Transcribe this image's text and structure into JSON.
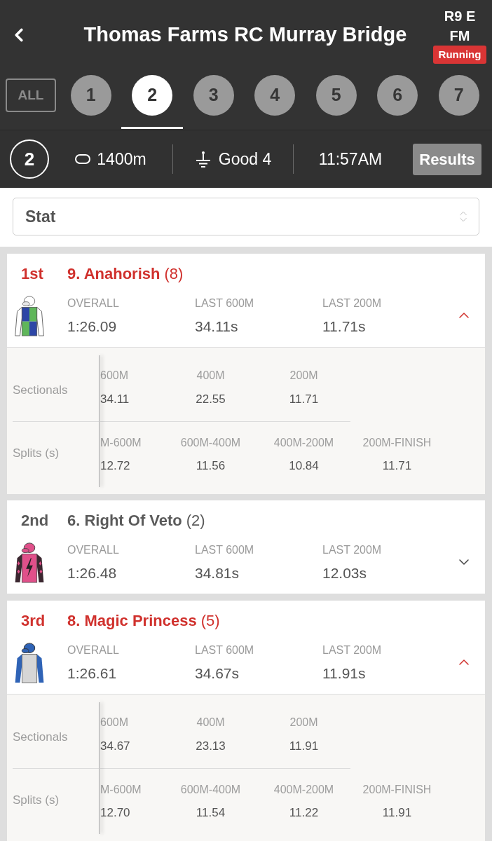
{
  "header": {
    "title": "Thomas Farms RC Murray Bridge",
    "race_code": [
      "R9 E",
      "FM"
    ],
    "status": "Running"
  },
  "race_tabs": [
    {
      "kind": "all",
      "label": "ALL",
      "selected": false
    },
    {
      "kind": "number",
      "label": "1",
      "selected": false
    },
    {
      "kind": "number",
      "label": "2",
      "selected": true
    },
    {
      "kind": "number",
      "label": "3",
      "selected": false
    },
    {
      "kind": "number",
      "label": "4",
      "selected": false
    },
    {
      "kind": "number",
      "label": "5",
      "selected": false
    },
    {
      "kind": "number",
      "label": "6",
      "selected": false
    },
    {
      "kind": "number",
      "label": "7",
      "selected": false
    }
  ],
  "race_info": {
    "number": "2",
    "distance": "1400m",
    "track_condition": "Good 4",
    "time": "11:57AM",
    "results_button": "Results"
  },
  "stat_select": {
    "value": "Stat"
  },
  "runners": [
    {
      "place": "1st",
      "name": "9. Anahorish",
      "barrier": "(8)",
      "silk": {
        "kind": "quartered"
      },
      "expanded": true,
      "stats": [
        {
          "label": "OVERALL",
          "value": "1:26.09"
        },
        {
          "label": "LAST 600M",
          "value": "34.11s"
        },
        {
          "label": "LAST 200M",
          "value": "11.71s"
        }
      ],
      "sectionals": {
        "label": "Sectionals",
        "columns": [
          {
            "header": "600M",
            "value": "34.11"
          },
          {
            "header": "400M",
            "value": "22.55"
          },
          {
            "header": "200M",
            "value": "11.71"
          }
        ]
      },
      "splits": {
        "label": "Splits (s)",
        "columns": [
          {
            "header": "M-600M",
            "value": "12.72"
          },
          {
            "header": "600M-400M",
            "value": "11.56"
          },
          {
            "header": "400M-200M",
            "value": "10.84"
          },
          {
            "header": "200M-FINISH",
            "value": "11.71"
          }
        ]
      }
    },
    {
      "place": "2nd",
      "name": "6. Right Of Veto",
      "barrier": "(2)",
      "silk": {
        "kind": "bolt"
      },
      "expanded": false,
      "stats": [
        {
          "label": "OVERALL",
          "value": "1:26.48"
        },
        {
          "label": "LAST 600M",
          "value": "34.81s"
        },
        {
          "label": "LAST 200M",
          "value": "12.03s"
        }
      ]
    },
    {
      "place": "3rd",
      "name": "8. Magic Princess",
      "barrier": "(5)",
      "silk": {
        "kind": "plain"
      },
      "expanded": true,
      "stats": [
        {
          "label": "OVERALL",
          "value": "1:26.61"
        },
        {
          "label": "LAST 600M",
          "value": "34.67s"
        },
        {
          "label": "LAST 200M",
          "value": "11.91s"
        }
      ],
      "sectionals": {
        "label": "Sectionals",
        "columns": [
          {
            "header": "600M",
            "value": "34.67"
          },
          {
            "header": "400M",
            "value": "23.13"
          },
          {
            "header": "200M",
            "value": "11.91"
          }
        ]
      },
      "splits": {
        "label": "Splits (s)",
        "columns": [
          {
            "header": "M-600M",
            "value": "12.70"
          },
          {
            "header": "600M-400M",
            "value": "11.54"
          },
          {
            "header": "400M-200M",
            "value": "11.22"
          },
          {
            "header": "200M-FINISH",
            "value": "11.91"
          }
        ]
      }
    }
  ]
}
